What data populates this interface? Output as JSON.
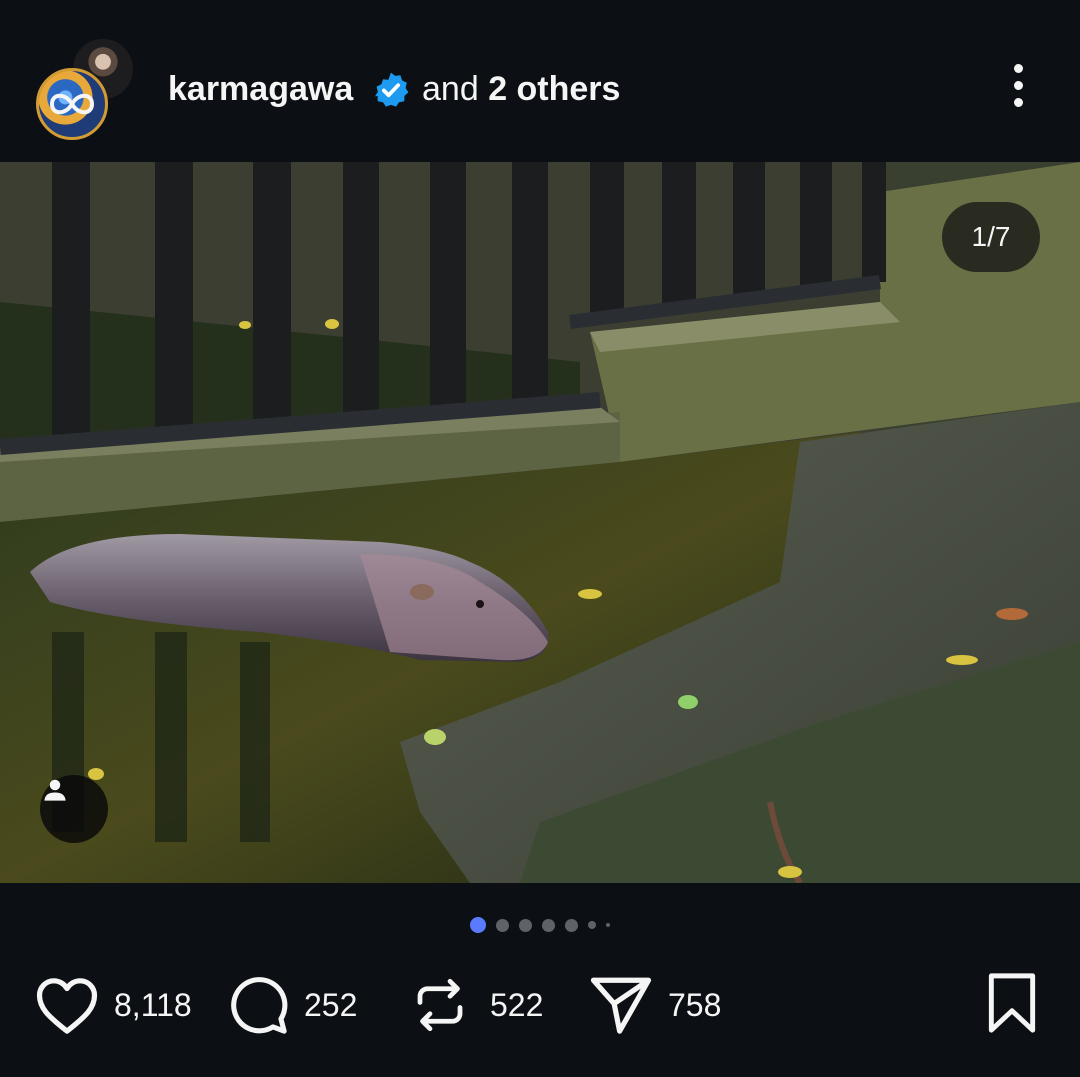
{
  "header": {
    "username": "karmagawa",
    "and_text": "and",
    "others_text": "2 others"
  },
  "photo": {
    "counter": "1/7"
  },
  "carousel": {
    "total_dots": 7,
    "active_index": 0
  },
  "actions": {
    "likes": "8,118",
    "comments": "252",
    "reposts": "522",
    "shares": "758"
  },
  "colors": {
    "background": "#0c1014",
    "text": "#f5f5f5",
    "verified": "#1d9bf0",
    "active_dot": "#5b7bff"
  },
  "icons": [
    "more-vertical-icon",
    "verified-badge-icon",
    "user-tag-icon",
    "heart-icon",
    "comment-icon",
    "repost-icon",
    "share-icon",
    "bookmark-icon"
  ]
}
